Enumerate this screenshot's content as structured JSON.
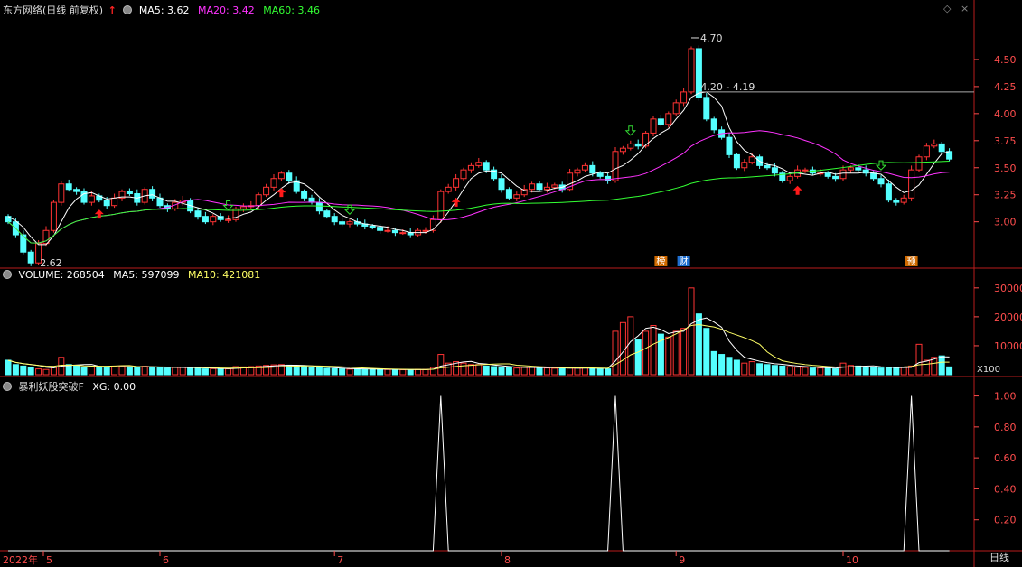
{
  "header": {
    "stock_title": "东方网络(日线 前复权)",
    "ma5_label": "MA5: 3.62",
    "ma20_label": "MA20: 3.42",
    "ma60_label": "MA60: 3.46"
  },
  "volume_header": {
    "title": "VOLUME: 268504",
    "ma5_label": "MA5: 597099",
    "ma10_label": "MA10: 421081",
    "unit": "X100"
  },
  "indicator_header": {
    "title": "暴利妖股突破F",
    "xg_label": "XG: 0.00"
  },
  "window_controls": {
    "restore": "◇",
    "close": "×"
  },
  "period_button": "日线",
  "colors": {
    "up": "#ff3333",
    "down": "#54ffff",
    "ma5": "#ffffff",
    "ma20": "#ff33ff",
    "ma60": "#33ff33",
    "vma10": "#ffff66",
    "axis": "#b81c1c",
    "tick": "#ff4d4d"
  },
  "chart_data": [
    {
      "type": "candlestick",
      "title": "东方网络(日线 前复权)",
      "ylim": [
        2.58,
        4.85
      ],
      "y_ticks": [
        3.0,
        3.25,
        3.5,
        3.75,
        4.0,
        4.25,
        4.5
      ],
      "y_tick_labels": [
        "3.00",
        "3.25",
        "3.50",
        "3.75",
        "4.00",
        "4.25",
        "4.50"
      ],
      "annotations": {
        "high_label": "4.70",
        "low_label": "2.62",
        "level_label": "4.20 - 4.19",
        "event_badges": [
          "榜",
          "财",
          "预"
        ]
      },
      "close": [
        3.0,
        2.88,
        2.72,
        2.62,
        2.8,
        2.92,
        3.18,
        3.35,
        3.3,
        3.28,
        3.18,
        3.24,
        3.2,
        3.15,
        3.22,
        3.28,
        3.26,
        3.18,
        3.3,
        3.22,
        3.15,
        3.12,
        3.18,
        3.2,
        3.1,
        3.05,
        3.0,
        3.05,
        3.02,
        3.02,
        3.12,
        3.14,
        3.15,
        3.25,
        3.32,
        3.4,
        3.45,
        3.38,
        3.28,
        3.22,
        3.18,
        3.1,
        3.05,
        3.0,
        2.98,
        3.0,
        2.98,
        2.96,
        2.95,
        2.92,
        2.92,
        2.9,
        2.9,
        2.88,
        2.92,
        2.92,
        3.02,
        3.28,
        3.32,
        3.4,
        3.48,
        3.52,
        3.55,
        3.48,
        3.4,
        3.3,
        3.22,
        3.25,
        3.3,
        3.35,
        3.3,
        3.32,
        3.34,
        3.3,
        3.45,
        3.48,
        3.52,
        3.45,
        3.42,
        3.38,
        3.65,
        3.68,
        3.72,
        3.7,
        3.82,
        3.95,
        3.9,
        4.0,
        4.1,
        4.2,
        4.6,
        4.15,
        3.95,
        3.85,
        3.78,
        3.62,
        3.5,
        3.55,
        3.6,
        3.52,
        3.5,
        3.45,
        3.38,
        3.42,
        3.48,
        3.48,
        3.45,
        3.45,
        3.42,
        3.4,
        3.48,
        3.5,
        3.48,
        3.45,
        3.4,
        3.35,
        3.2,
        3.18,
        3.22,
        3.48,
        3.6,
        3.7,
        3.72,
        3.65,
        3.58
      ],
      "ma5": [
        3.05,
        3.01,
        2.95,
        2.86,
        2.79,
        2.79,
        2.87,
        3.0,
        3.13,
        3.21,
        3.26,
        3.27,
        3.24,
        3.21,
        3.22,
        3.23,
        3.23,
        3.22,
        3.24,
        3.25,
        3.22,
        3.19,
        3.19,
        3.17,
        3.15,
        3.13,
        3.11,
        3.08,
        3.04,
        3.03,
        3.04,
        3.07,
        3.09,
        3.14,
        3.2,
        3.25,
        3.31,
        3.36,
        3.37,
        3.35,
        3.3,
        3.23,
        3.17,
        3.11,
        3.06,
        3.03,
        3.0,
        2.98,
        2.97,
        2.96,
        2.95,
        2.93,
        2.92,
        2.9,
        2.9,
        2.9,
        2.93,
        3.0,
        3.09,
        3.19,
        3.3,
        3.4,
        3.45,
        3.47,
        3.47,
        3.45,
        3.39,
        3.33,
        3.29,
        3.28,
        3.28,
        3.29,
        3.31,
        3.32,
        3.35,
        3.38,
        3.42,
        3.44,
        3.46,
        3.45,
        3.49,
        3.52,
        3.57,
        3.63,
        3.71,
        3.77,
        3.82,
        3.86,
        3.95,
        4.03,
        4.15,
        4.19,
        4.2,
        4.15,
        4.07,
        3.87,
        3.74,
        3.66,
        3.62,
        3.56,
        3.53,
        3.52,
        3.49,
        3.45,
        3.45,
        3.44,
        3.43,
        3.45,
        3.46,
        3.44,
        3.45,
        3.45,
        3.45,
        3.46,
        3.45,
        3.44,
        3.38,
        3.32,
        3.27,
        3.29,
        3.34,
        3.44,
        3.54,
        3.63,
        3.65
      ],
      "ma20_label": "MA20: 3.42",
      "ma60_label": "MA60: 3.46"
    },
    {
      "type": "bar",
      "title": "VOLUME: 268504",
      "unit": "X100",
      "ylim": [
        0,
        34000
      ],
      "y_ticks": [
        10000,
        20000,
        30000
      ],
      "y_tick_labels": [
        "10000",
        "20000",
        "30000"
      ],
      "values": [
        5000,
        3500,
        3000,
        2500,
        2000,
        1800,
        2500,
        6000,
        3500,
        3000,
        2500,
        2800,
        2600,
        2500,
        2800,
        3000,
        2700,
        2600,
        2900,
        2600,
        2400,
        2300,
        2500,
        2600,
        2400,
        2200,
        2000,
        2100,
        2000,
        2000,
        2800,
        2700,
        2800,
        3000,
        3200,
        3400,
        3500,
        3300,
        3000,
        2800,
        2600,
        2400,
        2200,
        2100,
        2000,
        1900,
        2000,
        1900,
        1900,
        1800,
        1800,
        1700,
        1700,
        1700,
        1800,
        1800,
        2500,
        7000,
        4000,
        4500,
        4000,
        3500,
        3500,
        3000,
        2800,
        2600,
        2400,
        2300,
        2500,
        2600,
        2400,
        2300,
        2200,
        2100,
        2300,
        2300,
        2400,
        2200,
        2000,
        2000,
        15000,
        18000,
        20000,
        12000,
        15000,
        17000,
        14000,
        13000,
        15000,
        16000,
        30000,
        21000,
        16000,
        8000,
        7000,
        6000,
        5000,
        4000,
        4500,
        3800,
        3500,
        3200,
        3000,
        2800,
        2600,
        2500,
        2300,
        2300,
        2200,
        2000,
        4000,
        3200,
        3000,
        2600,
        2500,
        2300,
        2500,
        2400,
        2500,
        3000,
        10500,
        5000,
        6000,
        6500,
        2700
      ],
      "vma5_label": "MA5: 597099",
      "vma10_label": "MA10: 421081"
    },
    {
      "type": "line",
      "title": "暴利妖股突破F",
      "series": [
        {
          "name": "XG",
          "signal_days": [
            57,
            80,
            119
          ],
          "value": 1
        }
      ],
      "ylim": [
        0,
        1.05
      ],
      "y_ticks": [
        0.2,
        0.4,
        0.6,
        0.8,
        1.0
      ],
      "y_tick_labels": [
        "0.20",
        "0.40",
        "0.60",
        "0.80",
        "1.00"
      ]
    }
  ],
  "x_axis": {
    "year_label": "2022年",
    "months": [
      {
        "label": "5",
        "day": 0
      },
      {
        "label": "6",
        "day": 20
      },
      {
        "label": "7",
        "day": 43
      },
      {
        "label": "8",
        "day": 65
      },
      {
        "label": "9",
        "day": 88
      },
      {
        "label": "10",
        "day": 110
      }
    ]
  }
}
